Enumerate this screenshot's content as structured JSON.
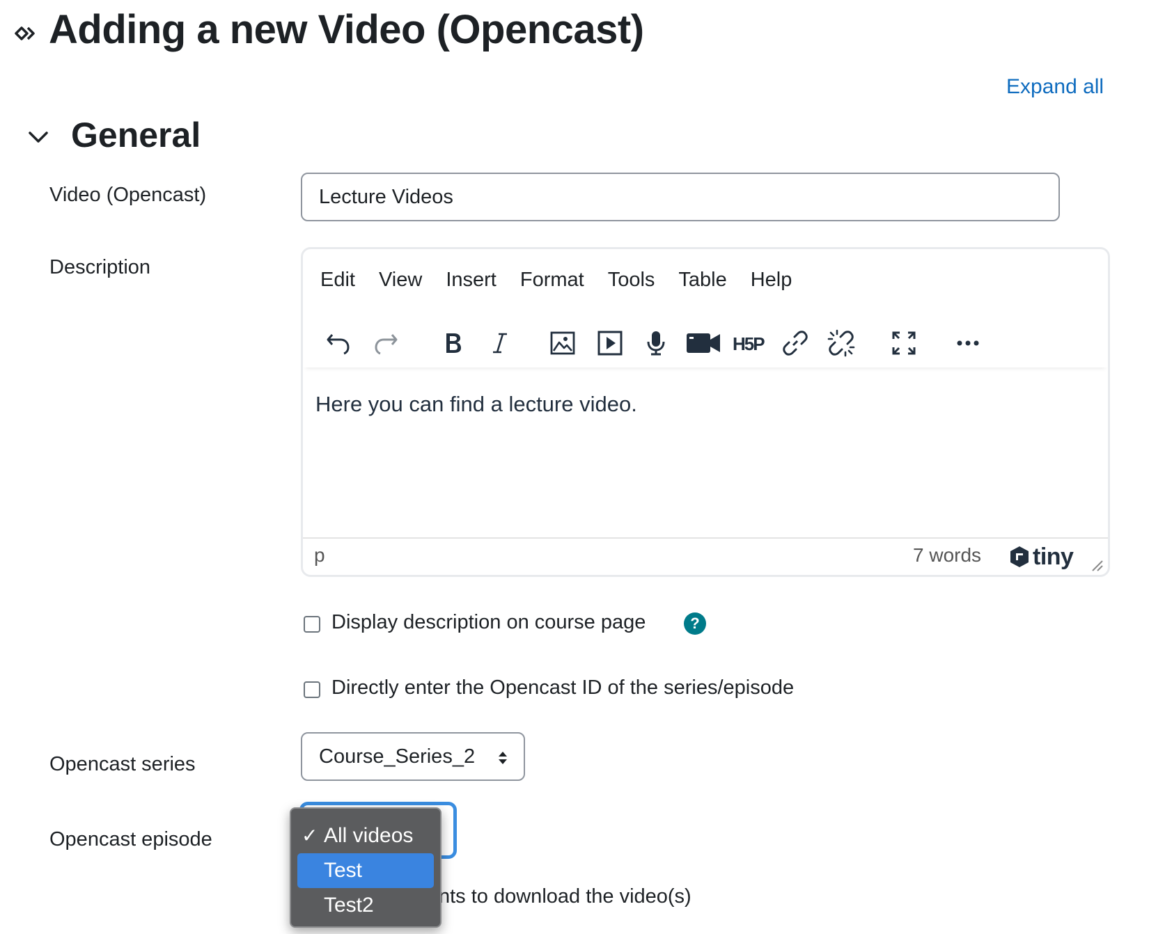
{
  "page": {
    "title": "Adding a new Video (Opencast)",
    "expand_all": "Expand all"
  },
  "section": {
    "title": "General"
  },
  "fields": {
    "name": {
      "label": "Video (Opencast)",
      "value": "Lecture Videos"
    },
    "description": {
      "label": "Description"
    },
    "display_description": {
      "label": "Display description on course page",
      "checked": false
    },
    "direct_id": {
      "label": "Directly enter the Opencast ID of the series/episode",
      "checked": false
    },
    "series": {
      "label": "Opencast series",
      "value": "Course_Series_2"
    },
    "episode": {
      "label": "Opencast episode",
      "options": [
        {
          "label": "All videos",
          "selected": true
        },
        {
          "label": "Test",
          "highlighted": true
        },
        {
          "label": "Test2"
        }
      ]
    },
    "download_partial": "nts to download the video(s)"
  },
  "editor": {
    "menu": [
      "Edit",
      "View",
      "Insert",
      "Format",
      "Tools",
      "Table",
      "Help"
    ],
    "toolbar": [
      "undo-icon",
      "redo-icon",
      "bold-icon",
      "italic-icon",
      "image-icon",
      "media-icon",
      "audio-record-icon",
      "video-record-icon",
      "h5p-icon",
      "link-icon",
      "unlink-icon",
      "fullscreen-icon",
      "more-icon"
    ],
    "content": "Here you can find a lecture video.",
    "path": "p",
    "word_count": "7 words",
    "brand": "tiny"
  },
  "colors": {
    "link": "#0f6cbf",
    "help": "#007b8a",
    "focus": "#3a8de0",
    "dropdown_bg": "#5b5c5e",
    "dropdown_highlight": "#3a84e0"
  }
}
